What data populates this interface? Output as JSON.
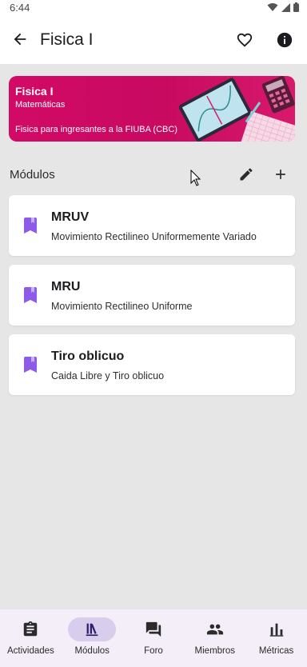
{
  "status_bar": {
    "time": "6:44"
  },
  "app_bar": {
    "title": "Fisica I"
  },
  "banner": {
    "title": "Fisica I",
    "subject": "Matemáticas",
    "description": "Fisica para ingresantes a la FIUBA (CBC)"
  },
  "section": {
    "title": "Módulos"
  },
  "modules": [
    {
      "title": "MRUV",
      "subtitle": "Movimiento Rectilineo Uniformemente Variado"
    },
    {
      "title": "MRU",
      "subtitle": "Movimiento Rectilineo Uniforme"
    },
    {
      "title": "Tiro oblicuo",
      "subtitle": "Caida Libre y Tiro oblicuo"
    }
  ],
  "nav": {
    "items": [
      {
        "label": "Actividades",
        "icon": "clipboard-icon"
      },
      {
        "label": "Módulos",
        "icon": "library-icon"
      },
      {
        "label": "Foro",
        "icon": "forum-icon"
      },
      {
        "label": "Miembros",
        "icon": "people-icon"
      },
      {
        "label": "Métricas",
        "icon": "bar-chart-icon"
      }
    ],
    "active_index": 1
  },
  "colors": {
    "banner": "#d10a66",
    "accent": "#8e5be8",
    "nav_active": "#d9cdee"
  }
}
